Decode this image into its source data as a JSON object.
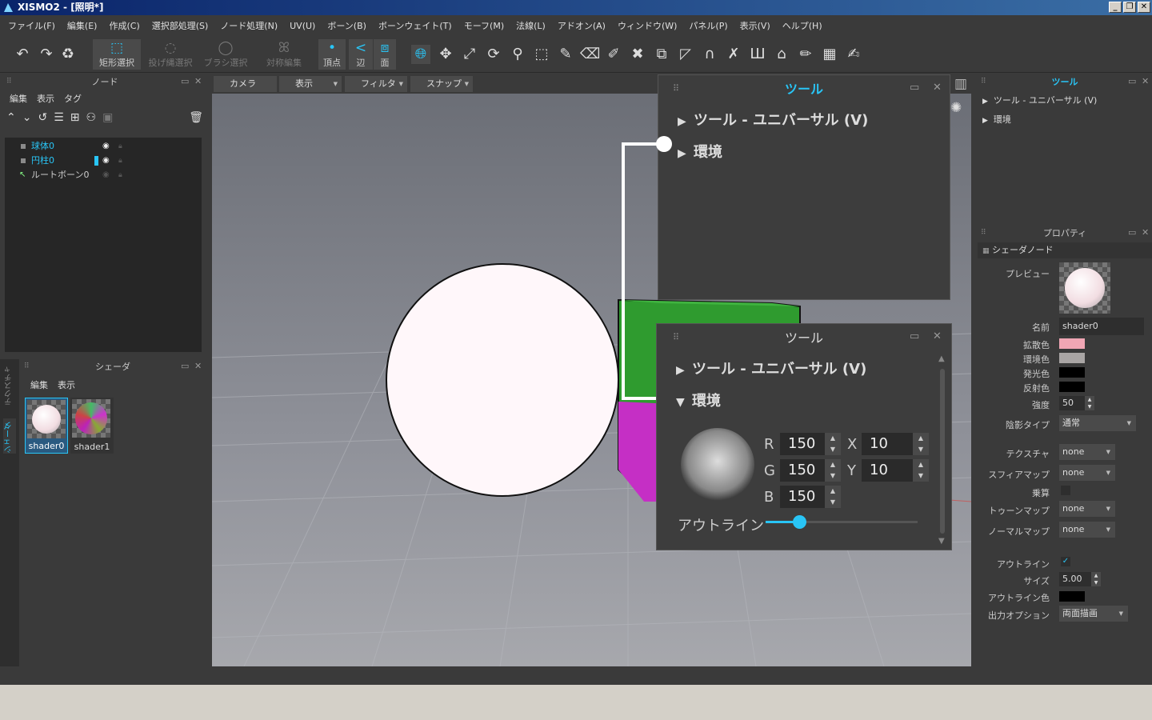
{
  "window": {
    "title": "XISMO2 - [照明*]",
    "min": "_",
    "restore": "❐",
    "close": "✕"
  },
  "menu": [
    "ファイル(F)",
    "編集(E)",
    "作成(C)",
    "選択部処理(S)",
    "ノード処理(N)",
    "UV(U)",
    "ボーン(B)",
    "ボーンウェイト(T)",
    "モーフ(M)",
    "法線(L)",
    "アドオン(A)",
    "ウィンドウ(W)",
    "パネル(P)",
    "表示(V)",
    "ヘルプ(H)"
  ],
  "toolbar": {
    "undo": "↶",
    "redo": "↷",
    "recycle": "♻",
    "rect_select": "矩形選択",
    "lasso_select": "投げ縄選択",
    "brush_select": "ブラシ選択",
    "symmetry_edit": "対称編集",
    "vertex": "頂点",
    "edge": "辺",
    "face": "面"
  },
  "node_panel": {
    "title": "ノード",
    "menu": [
      "編集",
      "表示",
      "タグ"
    ],
    "items": [
      {
        "label": "球体0"
      },
      {
        "label": "円柱0"
      },
      {
        "label": "ルートボーン0"
      }
    ]
  },
  "shader_panel": {
    "title": "シェーダ",
    "menu": [
      "編集",
      "表示"
    ],
    "items": [
      {
        "label": "shader0"
      },
      {
        "label": "shader1"
      }
    ],
    "side_tabs": [
      "テクスチャ",
      "シェーダ"
    ]
  },
  "viewport": {
    "tabs": [
      "カメラ",
      "表示",
      "フィルタ",
      "スナップ"
    ]
  },
  "tool_window_top": {
    "title": "ツール",
    "rows": [
      "ツール - ユニバーサル (V)",
      "環境"
    ]
  },
  "tool_window_front": {
    "title": "ツール",
    "rows": [
      "ツール - ユニバーサル (V)",
      "環境"
    ],
    "r_label": "R",
    "r": "150",
    "g_label": "G",
    "g": "150",
    "b_label": "B",
    "b": "150",
    "x_label": "X",
    "x": "10",
    "y_label": "Y",
    "y": "10",
    "outline_label": "アウトライン",
    "outline_slider": 0.22
  },
  "right_tool": {
    "title": "ツール",
    "items": [
      "ツール - ユニバーサル (V)",
      "環境"
    ]
  },
  "props": {
    "title": "プロパティ",
    "section": "シェーダノード",
    "preview": "プレビュー",
    "name_label": "名前",
    "name": "shader0",
    "diffuse_label": "拡散色",
    "diffuse": "#f0a6b4",
    "ambient_label": "環境色",
    "ambient": "#a9a5a4",
    "emissive_label": "発光色",
    "emissive": "#000000",
    "specular_label": "反射色",
    "specular": "#000000",
    "strength_label": "強度",
    "strength": "50",
    "shadow_type_label": "陰影タイプ",
    "shadow_type": "通常",
    "texture_label": "テクスチャ",
    "texture": "none",
    "sphere_map_label": "スフィアマップ",
    "sphere_map": "none",
    "multiply_label": "乗算",
    "toon_map_label": "トゥーンマップ",
    "toon_map": "none",
    "normal_map_label": "ノーマルマップ",
    "normal_map": "none",
    "outline_label": "アウトライン",
    "outline_check": "✓",
    "size_label": "サイズ",
    "size": "5.00",
    "outline_color_label": "アウトライン色",
    "outline_color": "#000000",
    "output_option_label": "出力オプション",
    "output_option": "両面描画"
  },
  "colors": {
    "accent": "#29c5f6",
    "panel": "#3a3a3a"
  }
}
